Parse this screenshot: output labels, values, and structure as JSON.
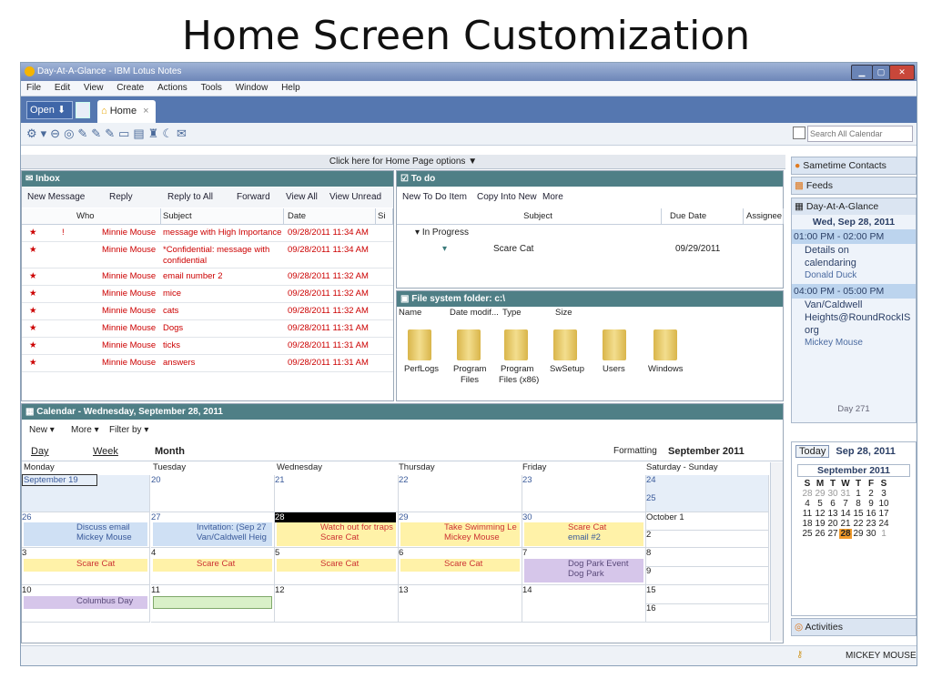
{
  "slide_title": "Home Screen Customization",
  "window": {
    "title": "Day-At-A-Glance - IBM Lotus Notes"
  },
  "menu": [
    "File",
    "Edit",
    "View",
    "Create",
    "Actions",
    "Tools",
    "Window",
    "Help"
  ],
  "tabs": {
    "open_label": "Open",
    "home_label": "Home",
    "close": "×"
  },
  "search": {
    "placeholder": "Search All Calendar"
  },
  "home_options": "Click here for Home Page options",
  "inbox": {
    "title": "Inbox",
    "actions": [
      "New Message",
      "Reply",
      "Reply to All",
      "Forward",
      "View All",
      "View Unread"
    ],
    "columns": {
      "who": "Who",
      "subject": "Subject",
      "date": "Date",
      "size": "Si"
    },
    "rows": [
      {
        "who": "Minnie Mouse",
        "subject": "message with High Importance",
        "date": "09/28/2011 11:34 AM",
        "flag": "!"
      },
      {
        "who": "Minnie Mouse",
        "subject": "*Confidential: message with",
        "subject2": "confidential",
        "date": "09/28/2011 11:34 AM",
        "flag": ""
      },
      {
        "who": "Minnie Mouse",
        "subject": "email number 2",
        "date": "09/28/2011 11:32 AM",
        "flag": ""
      },
      {
        "who": "Minnie Mouse",
        "subject": "mice",
        "date": "09/28/2011 11:32 AM",
        "flag": ""
      },
      {
        "who": "Minnie Mouse",
        "subject": "cats",
        "date": "09/28/2011 11:32 AM",
        "flag": ""
      },
      {
        "who": "Minnie Mouse",
        "subject": "Dogs",
        "date": "09/28/2011 11:31 AM",
        "flag": ""
      },
      {
        "who": "Minnie Mouse",
        "subject": "ticks",
        "date": "09/28/2011 11:31 AM",
        "flag": ""
      },
      {
        "who": "Minnie Mouse",
        "subject": "answers",
        "date": "09/28/2011 11:31 AM",
        "flag": ""
      }
    ]
  },
  "todo": {
    "title": "To do",
    "actions": [
      "New To Do Item",
      "Copy Into New",
      "More"
    ],
    "columns": {
      "subject": "Subject",
      "due": "Due Date",
      "assignee": "Assignee"
    },
    "group": "In Progress",
    "item": {
      "subject": "Scare Cat",
      "due": "09/29/2011"
    }
  },
  "files": {
    "title": "File system folder: c:\\",
    "columns": [
      "Name",
      "Date modif...",
      "Type",
      "Size"
    ],
    "items": [
      {
        "l1": "PerfLogs",
        "l2": ""
      },
      {
        "l1": "Program",
        "l2": "Files"
      },
      {
        "l1": "Program",
        "l2": "Files (x86)"
      },
      {
        "l1": "SwSetup",
        "l2": ""
      },
      {
        "l1": "Users",
        "l2": ""
      },
      {
        "l1": "Windows",
        "l2": ""
      }
    ]
  },
  "calendar": {
    "title": "Calendar - Wednesday, September 28, 2011",
    "actions": [
      "New",
      "More",
      "Filter by"
    ],
    "views": [
      "Day",
      "Week",
      "Month"
    ],
    "formatting": "Formatting",
    "month_label": "September 2011",
    "days": [
      "Monday",
      "Tuesday",
      "Wednesday",
      "Thursday",
      "Friday",
      "Saturday - Sunday"
    ],
    "week1": [
      "September 19",
      "20",
      "21",
      "22",
      "23",
      "24",
      "25"
    ],
    "week2": [
      "26",
      "27",
      "28",
      "29",
      "30",
      "October 1",
      "2"
    ],
    "week3": [
      "3",
      "4",
      "5",
      "6",
      "7",
      "8",
      "9"
    ],
    "week4": [
      "10",
      "11",
      "12",
      "13",
      "14",
      "15",
      "16"
    ],
    "events": {
      "mon26_a": "Discuss email",
      "mon26_b": "Mickey Mouse",
      "tue27_a": "Invitation: (Sep 27",
      "tue27_b": "Van/Caldwell Heig",
      "wed28_a": "Watch out for traps",
      "wed28_b": "Scare Cat",
      "thu29_a": "Take Swimming Le",
      "thu29_b": "Mickey Mouse",
      "fri30_a": "Scare Cat",
      "fri30_b": "email #2",
      "mon3": "Scare Cat",
      "tue4": "Scare Cat",
      "wed5": "Scare Cat",
      "thu6": "Scare Cat",
      "fri7_a": "Dog Park Event",
      "fri7_b": "Dog Park",
      "mon10": "Columbus Day"
    }
  },
  "sidebar": {
    "sametime": "Sametime Contacts",
    "feeds": "Feeds",
    "dag": "Day-At-A-Glance",
    "date": "Wed, Sep 28, 2011",
    "slot1": "01:00 PM - 02:00 PM",
    "slot1_l1": "Details on",
    "slot1_l2": "calendaring",
    "slot1_l3": "Donald Duck",
    "slot2": "04:00 PM - 05:00 PM",
    "slot2_l1": "Van/Caldwell",
    "slot2_l2": "Heights@RoundRockIS",
    "slot2_l3": "org",
    "slot2_l4": "Mickey Mouse",
    "day_label": "Day 271",
    "today_btn": "Today",
    "today_date": "Sep 28, 2011",
    "mini_month": "September 2011",
    "mini_head": [
      "S",
      "M",
      "T",
      "W",
      "T",
      "F",
      "S"
    ],
    "mini_rows": [
      [
        "28",
        "29",
        "30",
        "31",
        "1",
        "2",
        "3"
      ],
      [
        "4",
        "5",
        "6",
        "7",
        "8",
        "9",
        "10"
      ],
      [
        "11",
        "12",
        "13",
        "14",
        "15",
        "16",
        "17"
      ],
      [
        "18",
        "19",
        "20",
        "21",
        "22",
        "23",
        "24"
      ],
      [
        "25",
        "26",
        "27",
        "28",
        "29",
        "30",
        "1"
      ]
    ],
    "activities": "Activities"
  },
  "status": {
    "user": "MICKEY MOUSE"
  },
  "colors": {
    "panel_header": "#4f7f86",
    "titlebar": "#6d86b8",
    "today": "#f29b2b",
    "event_yellow": "#fff2a8",
    "event_blue": "#cfe0f4",
    "event_purple": "#d6c6ea",
    "event_green": "#d9f0c8"
  }
}
